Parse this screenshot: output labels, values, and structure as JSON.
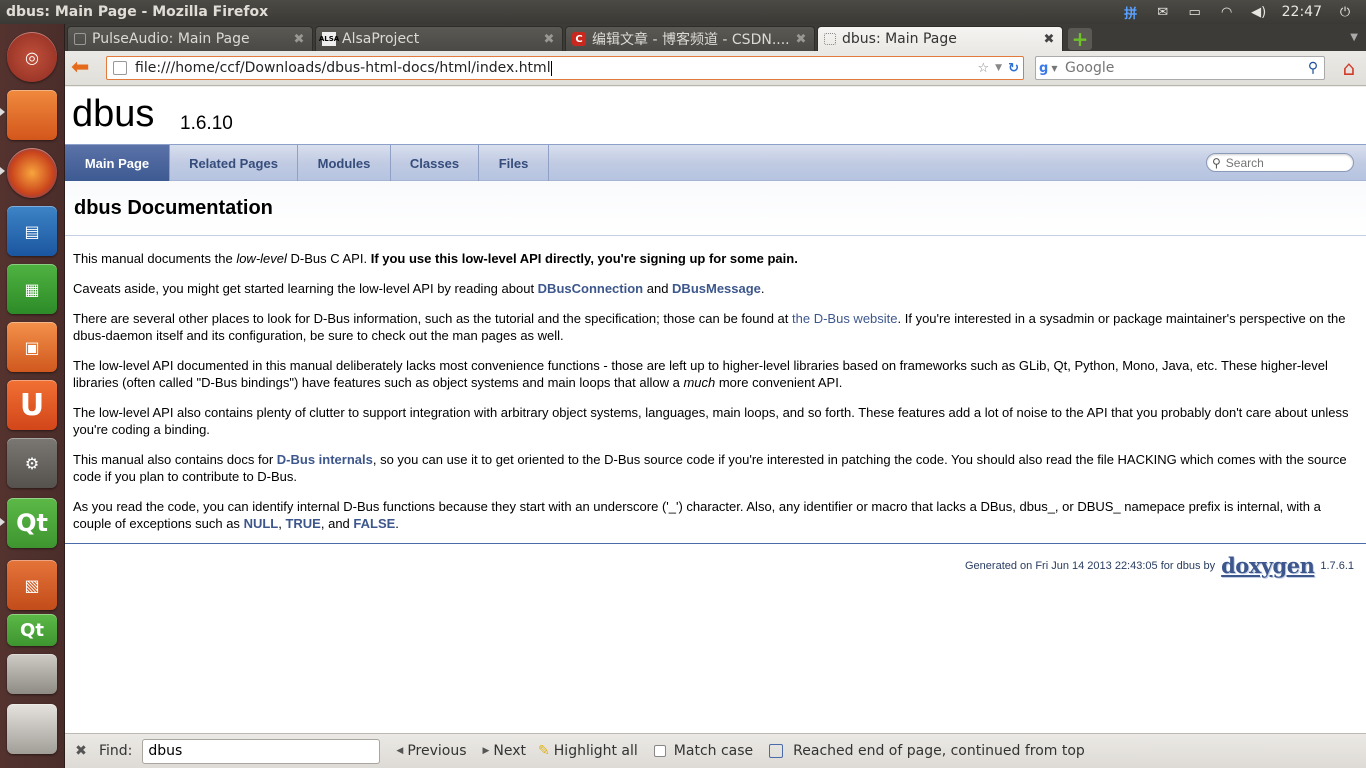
{
  "window": {
    "title": "dbus: Main Page - Mozilla Firefox"
  },
  "tray": {
    "input_method": "拼",
    "clock": "22:47",
    "icons": [
      "input-method-icon",
      "mail-icon",
      "battery-icon",
      "wifi-icon",
      "volume-icon"
    ]
  },
  "launcher": {
    "items": [
      "ubuntu-dash-icon",
      "files-icon",
      "firefox-icon",
      "writer-icon",
      "calc-icon",
      "software-center-icon",
      "ubuntu-one-icon",
      "system-settings-icon",
      "qt-creator-icon",
      "impress-icon",
      "qt-assistant-icon",
      "workspaces-icon",
      "trash-icon"
    ],
    "qt_label": "Qt"
  },
  "tabs": [
    {
      "label": "PulseAudio: Main Page",
      "active": false
    },
    {
      "label": "AlsaProject",
      "active": false,
      "favicon": "ALSA"
    },
    {
      "label": "编辑文章 - 博客频道 - CSDN....",
      "active": false,
      "favicon": "C"
    },
    {
      "label": "dbus: Main Page",
      "active": true
    }
  ],
  "navbar": {
    "url": "file:///home/ccf/Downloads/dbus-html-docs/html/index.html",
    "search_placeholder": "Google"
  },
  "doc": {
    "project_name": "dbus",
    "project_number": "1.6.10",
    "nav_tabs": [
      "Main Page",
      "Related Pages",
      "Modules",
      "Classes",
      "Files"
    ],
    "search_placeholder": "Search",
    "title": "dbus Documentation",
    "p1": {
      "a": "This manual documents the ",
      "em": "low-level",
      "b": " D-Bus C API. ",
      "strong": "If you use this low-level API directly, you're signing up for some pain."
    },
    "p2": {
      "a": "Caveats aside, you might get started learning the low-level API by reading about ",
      "link1": "DBusConnection",
      "b": " and ",
      "link2": "DBusMessage",
      "c": "."
    },
    "p3": {
      "a": "There are several other places to look for D-Bus information, such as the tutorial and the specification; those can be found at ",
      "link": "the D-Bus website",
      "b": ". If you're interested in a sysadmin or package maintainer's perspective on the dbus-daemon itself and its configuration, be sure to check out the man pages as well."
    },
    "p4": {
      "a": "The low-level API documented in this manual deliberately lacks most convenience functions - those are left up to higher-level libraries based on frameworks such as GLib, Qt, Python, Mono, Java, etc. These higher-level libraries (often called \"D-Bus bindings\") have features such as object systems and main loops that allow a ",
      "em": "much",
      "b": " more convenient API."
    },
    "p5": "The low-level API also contains plenty of clutter to support integration with arbitrary object systems, languages, main loops, and so forth. These features add a lot of noise to the API that you probably don't care about unless you're coding a binding.",
    "p6": {
      "a": "This manual also contains docs for ",
      "link": "D-Bus internals",
      "b": ", so you can use it to get oriented to the D-Bus source code if you're interested in patching the code. You should also read the file HACKING which comes with the source code if you plan to contribute to D-Bus."
    },
    "p7": {
      "a": "As you read the code, you can identify internal D-Bus functions because they start with an underscore ('_') character. Also, any identifier or macro that lacks a DBus, dbus_, or DBUS_ namepace prefix is internal, with a couple of exceptions such as ",
      "link1": "NULL",
      "b": ", ",
      "link2": "TRUE",
      "c": ", and ",
      "link3": "FALSE",
      "d": "."
    },
    "footer": {
      "generated": "Generated on Fri Jun 14 2013 22:43:05 for dbus by",
      "logo": "doxygen",
      "version": "1.7.6.1"
    }
  },
  "findbar": {
    "label": "Find:",
    "value": "dbus",
    "previous": "Previous",
    "next": "Next",
    "highlight_all": "Highlight all",
    "match_case": "Match case",
    "status": "Reached end of page, continued from top"
  }
}
